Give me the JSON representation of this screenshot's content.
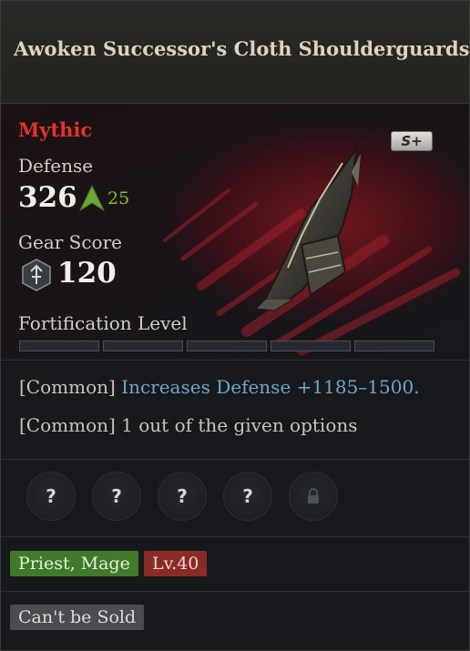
{
  "item": {
    "name": "Awoken Successor's Cloth Shoulderguards",
    "rarity": "Mythic",
    "grade_badge": "S+",
    "rarity_color": "#e0332c"
  },
  "stats": {
    "defense_label": "Defense",
    "defense_value": "326",
    "defense_increase": "25",
    "gear_score_label": "Gear Score",
    "gear_score_value": "120"
  },
  "fortification": {
    "label": "Fortification Level",
    "filled_segments": 0,
    "total_segments": 5
  },
  "options": [
    {
      "prefix": "[Common]",
      "text": "Increases Defense +1185–1500."
    },
    {
      "prefix": "[Common]",
      "text": "1 out of the given options"
    }
  ],
  "sockets": [
    {
      "symbol": "?",
      "state": "unknown"
    },
    {
      "symbol": "?",
      "state": "unknown"
    },
    {
      "symbol": "?",
      "state": "unknown"
    },
    {
      "symbol": "?",
      "state": "unknown"
    },
    {
      "symbol": "",
      "state": "locked"
    }
  ],
  "tags": {
    "classes": "Priest, Mage",
    "level": "Lv.40",
    "sell_status": "Can't be Sold"
  }
}
